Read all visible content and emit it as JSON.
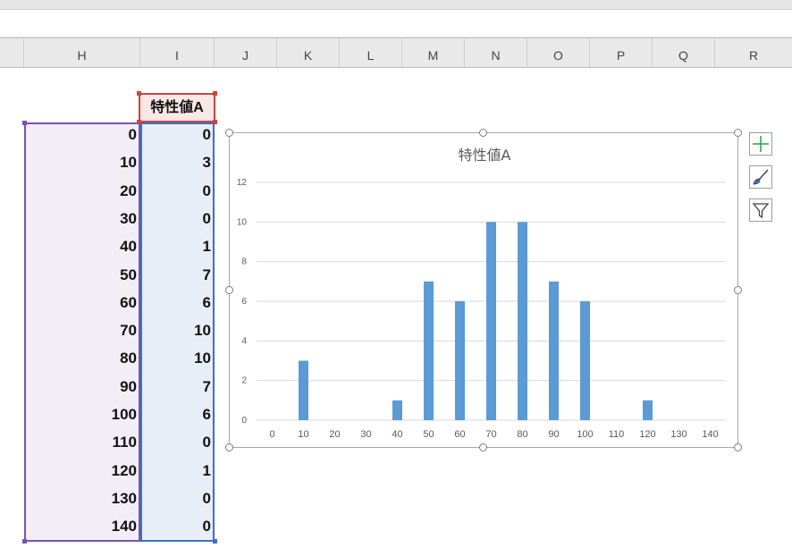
{
  "columns": [
    "H",
    "I",
    "J",
    "K",
    "L",
    "M",
    "N",
    "O",
    "P",
    "Q",
    "R"
  ],
  "column_H_values": [
    "0",
    "10",
    "20",
    "30",
    "40",
    "50",
    "60",
    "70",
    "80",
    "90",
    "100",
    "110",
    "120",
    "130",
    "140"
  ],
  "column_I_header": "特性値A",
  "column_I_values": [
    "0",
    "3",
    "0",
    "0",
    "1",
    "7",
    "6",
    "10",
    "10",
    "7",
    "6",
    "0",
    "1",
    "0",
    "0"
  ],
  "colors": {
    "bar": "#5b9bd5",
    "selection_H": "#7a52b3",
    "selection_I": "#3b6fc9",
    "header_border": "#c9463d"
  },
  "chart_buttons": [
    "plus-icon",
    "brush-icon",
    "filter-icon"
  ],
  "chart_data": {
    "type": "bar",
    "title": "特性値A",
    "categories": [
      "0",
      "10",
      "20",
      "30",
      "40",
      "50",
      "60",
      "70",
      "80",
      "90",
      "100",
      "110",
      "120",
      "130",
      "140"
    ],
    "values": [
      0,
      3,
      0,
      0,
      1,
      7,
      6,
      10,
      10,
      7,
      6,
      0,
      1,
      0,
      0
    ],
    "ylim": [
      0,
      12
    ],
    "yticks": [
      "0",
      "2",
      "4",
      "6",
      "8",
      "10",
      "12"
    ],
    "grid": true,
    "xlabel": "",
    "ylabel": ""
  }
}
